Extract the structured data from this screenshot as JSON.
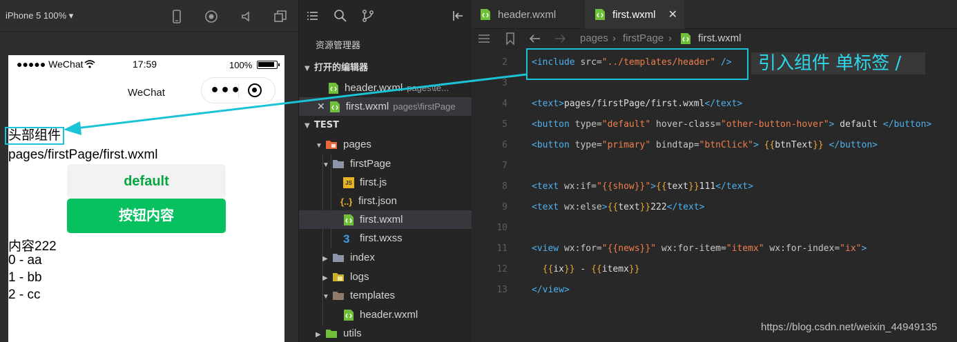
{
  "simulator": {
    "device_label": "iPhone 5 100% ▾",
    "status": {
      "signal": "●●●●● WeChat",
      "time": "17:59",
      "battery_pct": "100%"
    },
    "nav_title": "WeChat",
    "header_component": "头部组件",
    "page_path": "pages/firstPage/first.wxml",
    "btn_default": "default",
    "btn_primary": "按钮内容",
    "else_text": "内容222",
    "news": [
      "0 - aa",
      "1 - bb",
      "2 - cc"
    ]
  },
  "explorer": {
    "title": "资源管理器",
    "open_editors_label": "打开的编辑器",
    "open_editors": [
      {
        "name": "header.wxml",
        "path": "pages\\te..."
      },
      {
        "name": "first.wxml",
        "path": "pages\\firstPage"
      }
    ],
    "project_label": "TEST",
    "tree": {
      "pages": "pages",
      "firstPage": "firstPage",
      "first_js": "first.js",
      "first_json": "first.json",
      "first_wxml": "first.wxml",
      "first_wxss": "first.wxss",
      "index": "index",
      "logs": "logs",
      "templates": "templates",
      "header_wxml": "header.wxml",
      "utils": "utils"
    }
  },
  "editor": {
    "tabs": [
      {
        "label": "header.wxml"
      },
      {
        "label": "first.wxml",
        "close": "✕"
      }
    ],
    "breadcrumb": {
      "pages": "pages",
      "firstPage": "firstPage",
      "file": "first.wxml",
      "sep": "›"
    },
    "lines": {
      "2": {
        "n": "2",
        "a": "<include",
        "b": " src=",
        "c": "\"../templates/header\"",
        "d": " />"
      },
      "3": {
        "n": "3"
      },
      "4": {
        "n": "4",
        "a": "<text>",
        "b": "pages/firstPage/first.wxml",
        "c": "</text>"
      },
      "5": {
        "n": "5",
        "a": "<button",
        "b": " type=",
        "c": "\"default\"",
        "d": " hover-class=",
        "e": "\"other-button-hover\"",
        "f": ">",
        "g": " default ",
        "h": "</button>"
      },
      "6": {
        "n": "6",
        "a": "<button",
        "b": " type=",
        "c": "\"primary\"",
        "d": " bindtap=",
        "e": "\"btnClick\"",
        "f": ">",
        "g": " {{",
        "h": "btnText",
        "i": "}} ",
        "j": "</button>"
      },
      "7": {
        "n": "7"
      },
      "8": {
        "n": "8",
        "a": "<text",
        "b": " wx:if=",
        "c": "\"{{show}}\"",
        "d": ">",
        "e": "{{",
        "f": "text",
        "g": "}}",
        "h": "111",
        "i": "</text>"
      },
      "9": {
        "n": "9",
        "a": "<text",
        "b": " wx:else",
        "c": ">",
        "d": "{{",
        "e": "text",
        "f": "}}",
        "g": "222",
        "h": "</text>"
      },
      "10": {
        "n": "10"
      },
      "11": {
        "n": "11",
        "a": "<view",
        "b": " wx:for=",
        "c": "\"{{news}}\"",
        "d": " wx:for-item=",
        "e": "\"itemx\"",
        "f": " wx:for-index=",
        "g": "\"ix\"",
        "h": ">"
      },
      "12": {
        "n": "12",
        "a": "  {{",
        "b": "ix",
        "c": "}}",
        "d": " - ",
        "e": "{{",
        "f": "itemx",
        "g": "}}"
      },
      "13": {
        "n": "13",
        "a": "</view>"
      }
    },
    "annotation": "引入组件   单标签 /",
    "watermark": "https://blog.csdn.net/weixin_44949135"
  },
  "colors": {
    "accent_annotation": "#1ac3d6",
    "wechat_green": "#07c160",
    "tag_blue": "#4fb2ef",
    "string_orange": "#f07f4d"
  }
}
